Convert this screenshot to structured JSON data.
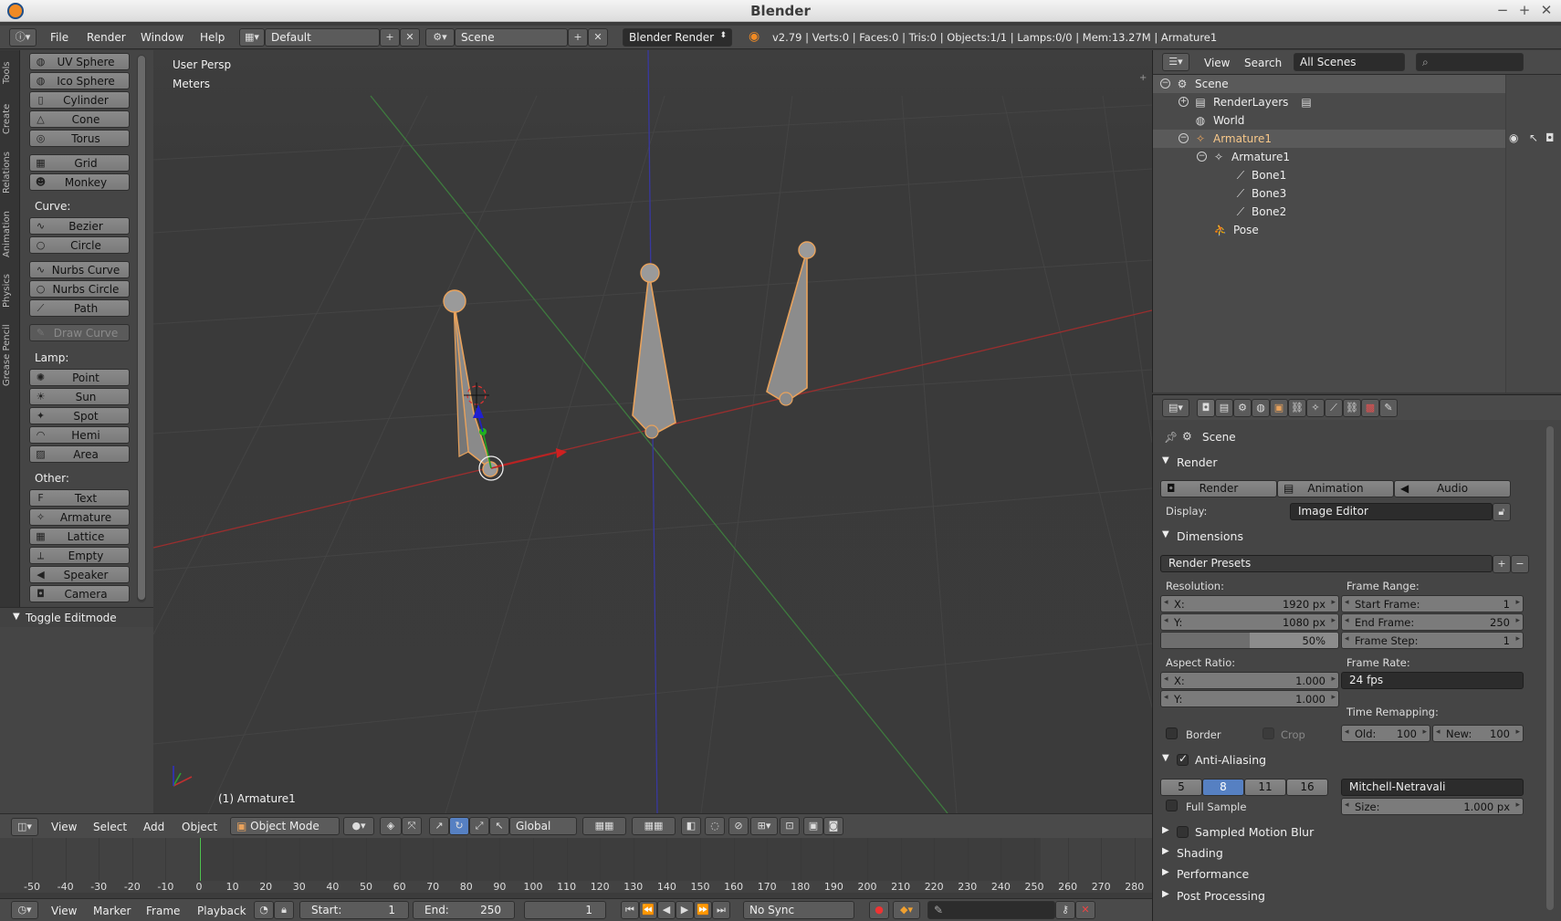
{
  "window": {
    "title": "Blender",
    "controls": [
      "−",
      "+",
      "✕"
    ]
  },
  "info_header": {
    "menus": [
      "File",
      "Render",
      "Window",
      "Help"
    ],
    "screen_layout": "Default",
    "scene": "Scene",
    "engine": "Blender Render",
    "stats": "v2.79 | Verts:0 | Faces:0 | Tris:0 | Objects:1/1 | Lamps:0/0 | Mem:13.27M | Armature1"
  },
  "tool_tabs": [
    "Tools",
    "Create",
    "Relations",
    "Animation",
    "Physics",
    "Grease Pencil"
  ],
  "toolshelf": {
    "mesh_items": [
      "UV Sphere",
      "Ico Sphere",
      "Cylinder",
      "Cone",
      "Torus",
      "Grid",
      "Monkey"
    ],
    "curve_label": "Curve:",
    "curve_items": [
      "Bezier",
      "Circle",
      "Nurbs Curve",
      "Nurbs Circle",
      "Path"
    ],
    "draw_curve": "Draw Curve",
    "lamp_label": "Lamp:",
    "lamp_items": [
      "Point",
      "Sun",
      "Spot",
      "Hemi",
      "Area"
    ],
    "other_label": "Other:",
    "other_items": [
      "Text",
      "Armature",
      "Lattice",
      "Empty",
      "Speaker",
      "Camera"
    ],
    "toggle_editmode": "Toggle Editmode"
  },
  "viewport": {
    "view_name": "User Persp",
    "units": "Meters",
    "object_label": "(1) Armature1"
  },
  "view3d_header": {
    "menus": [
      "View",
      "Select",
      "Add",
      "Object"
    ],
    "mode": "Object Mode",
    "orientation": "Global"
  },
  "timeline": {
    "ticks": [
      "-50",
      "-40",
      "-30",
      "-20",
      "-10",
      "0",
      "10",
      "20",
      "30",
      "40",
      "50",
      "60",
      "70",
      "80",
      "90",
      "100",
      "110",
      "120",
      "130",
      "140",
      "150",
      "160",
      "170",
      "180",
      "190",
      "200",
      "210",
      "220",
      "230",
      "240",
      "250",
      "260",
      "270",
      "280"
    ],
    "current_frame_marker": 0
  },
  "timeline_header": {
    "menus": [
      "View",
      "Marker",
      "Frame",
      "Playback"
    ],
    "start_label": "Start:",
    "start_value": "1",
    "end_label": "End:",
    "end_value": "250",
    "current_frame": "1",
    "sync": "No Sync"
  },
  "outliner": {
    "menus": [
      "View",
      "Search"
    ],
    "filter": "All Scenes",
    "tree": [
      {
        "label": "Scene",
        "depth": 0
      },
      {
        "label": "RenderLayers",
        "depth": 1
      },
      {
        "label": "World",
        "depth": 1
      },
      {
        "label": "Armature1",
        "depth": 1
      },
      {
        "label": "Armature1",
        "depth": 2
      },
      {
        "label": "Bone1",
        "depth": 3
      },
      {
        "label": "Bone3",
        "depth": 3
      },
      {
        "label": "Bone2",
        "depth": 3
      },
      {
        "label": "Pose",
        "depth": 2
      }
    ]
  },
  "properties": {
    "context": "Scene",
    "render_panel": "Render",
    "render_buttons": [
      "Render",
      "Animation",
      "Audio"
    ],
    "display_label": "Display:",
    "display_value": "Image Editor",
    "dimensions_panel": "Dimensions",
    "render_presets": "Render Presets",
    "resolution_label": "Resolution:",
    "res_x_label": "X:",
    "res_x": "1920 px",
    "res_y_label": "Y:",
    "res_y": "1080 px",
    "res_percent": "50%",
    "res_percent_fraction": 0.5,
    "frame_range_label": "Frame Range:",
    "start_frame_label": "Start Frame:",
    "start_frame": "1",
    "end_frame_label": "End Frame:",
    "end_frame": "250",
    "frame_step_label": "Frame Step:",
    "frame_step": "1",
    "aspect_label": "Aspect Ratio:",
    "aspect_x_label": "X:",
    "aspect_x": "1.000",
    "aspect_y_label": "Y:",
    "aspect_y": "1.000",
    "frame_rate_label": "Frame Rate:",
    "frame_rate": "24 fps",
    "time_remap_label": "Time Remapping:",
    "border": "Border",
    "crop": "Crop",
    "old_label": "Old:",
    "old_value": "100",
    "new_label": "New:",
    "new_value": "100",
    "aa_panel": "Anti-Aliasing",
    "aa_samples": [
      "5",
      "8",
      "11",
      "16"
    ],
    "aa_selected": "8",
    "aa_filter": "Mitchell-Netravali",
    "full_sample": "Full Sample",
    "size_label": "Size:",
    "size_value": "1.000 px",
    "collapsed_panels": [
      "Sampled Motion Blur",
      "Shading",
      "Performance",
      "Post Processing"
    ]
  },
  "colors": {
    "accent_blue": "#5680c2",
    "bone_orange": "#e8a25c",
    "axis_red": "#b03030",
    "axis_green": "#3e7a3e",
    "axis_blue": "#3c3ca8"
  }
}
